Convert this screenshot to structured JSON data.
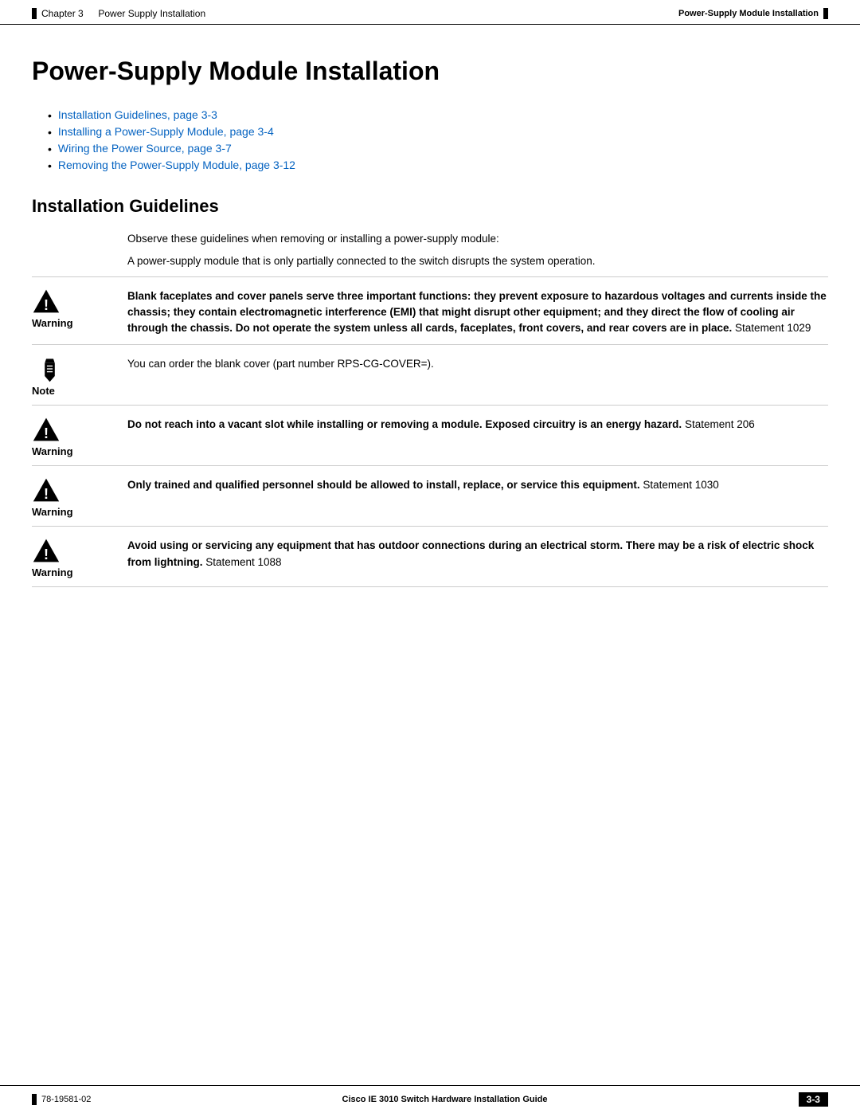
{
  "header": {
    "left_prefix": "Chapter 3",
    "left_title": "Power Supply Installation",
    "right_title": "Power-Supply Module Installation"
  },
  "page_title": "Power-Supply Module Installation",
  "toc": {
    "items": [
      {
        "label": "Installation Guidelines, page 3-3"
      },
      {
        "label": "Installing a Power-Supply Module, page 3-4"
      },
      {
        "label": "Wiring the Power Source, page 3-7"
      },
      {
        "label": "Removing the Power-Supply Module, page 3-12"
      }
    ]
  },
  "section": {
    "heading": "Installation Guidelines",
    "body_lines": [
      "Observe these guidelines when removing or installing a power-supply module:",
      "A power-supply module that is only partially connected to the switch disrupts the system operation."
    ]
  },
  "notices": [
    {
      "type": "warning",
      "label": "Warning",
      "bold_text": "Blank faceplates and cover panels serve three important functions: they prevent exposure to hazardous voltages and currents inside the chassis; they contain electromagnetic interference (EMI) that might disrupt other equipment; and they direct the flow of cooling air through the chassis. Do not operate the system unless all cards, faceplates, front covers, and rear covers are in place.",
      "normal_text": "\nStatement 1029"
    },
    {
      "type": "note",
      "label": "Note",
      "bold_text": "",
      "normal_text": "You can order the blank cover (part number RPS-CG-COVER=)."
    },
    {
      "type": "warning",
      "label": "Warning",
      "bold_text": "Do not reach into a vacant slot while installing or removing a module. Exposed circuitry is an energy hazard.",
      "normal_text": " Statement 206"
    },
    {
      "type": "warning",
      "label": "Warning",
      "bold_text": "Only trained and qualified personnel should be allowed to install, replace, or service this equipment.",
      "normal_text": "\nStatement 1030"
    },
    {
      "type": "warning",
      "label": "Warning",
      "bold_text": "Avoid using or servicing any equipment that has outdoor connections during an electrical storm. There may be a risk of electric shock from lightning.",
      "normal_text": " Statement 1088"
    }
  ],
  "footer": {
    "doc_number": "78-19581-02",
    "guide_title": "Cisco IE 3010 Switch Hardware Installation Guide",
    "page_number": "3-3"
  }
}
